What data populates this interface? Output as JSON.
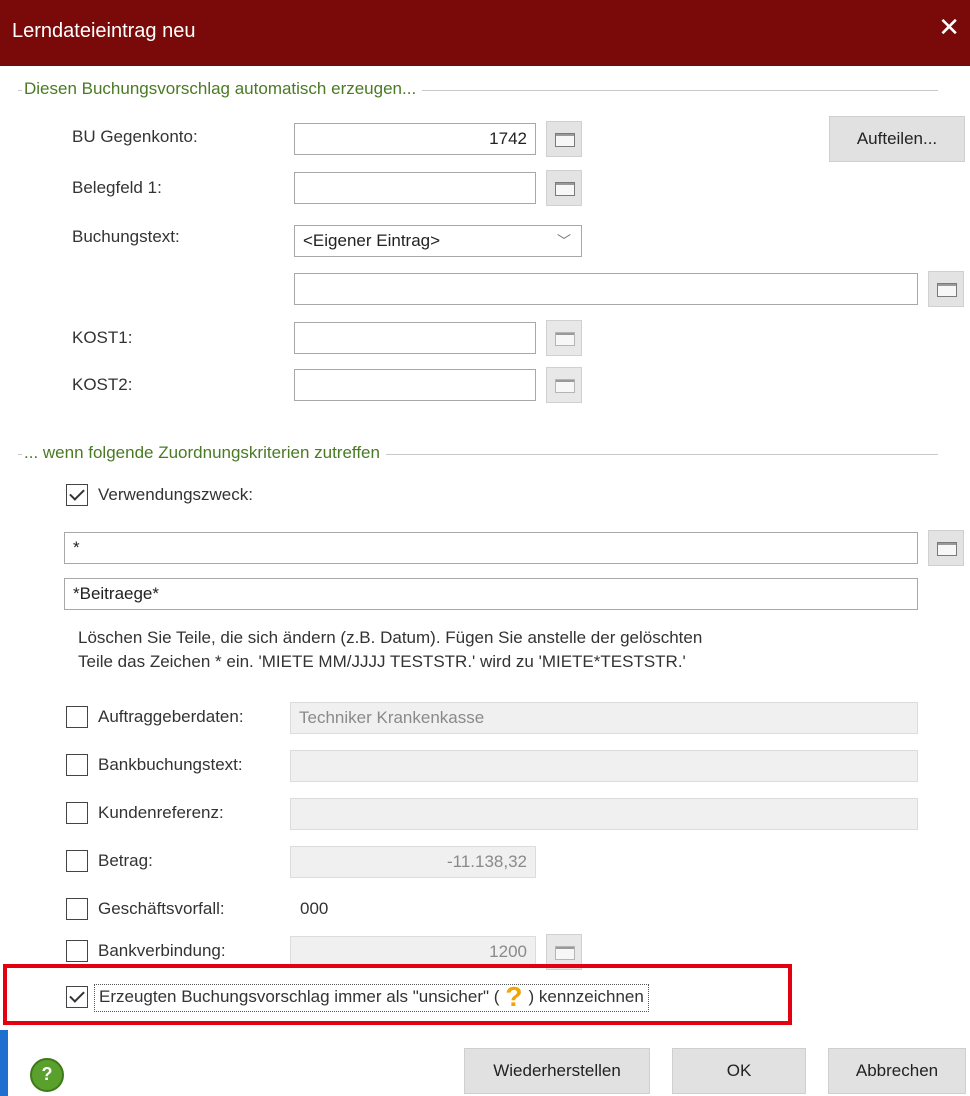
{
  "window": {
    "title": "Lerndateieintrag neu",
    "close_icon": "close-icon"
  },
  "group1": {
    "title": "Diesen Buchungsvorschlag automatisch erzeugen..."
  },
  "bu_gegenkonto": {
    "label": "BU Gegenkonto:",
    "value": "1742"
  },
  "belegfeld1": {
    "label": "Belegfeld 1:",
    "value": ""
  },
  "buchungstext": {
    "label": "Buchungstext:",
    "selected": "<Eigener Eintrag>",
    "text_value": ""
  },
  "aufteilen": {
    "label": "Aufteilen..."
  },
  "kost1": {
    "label": "KOST1:",
    "value": ""
  },
  "kost2": {
    "label": "KOST2:",
    "value": ""
  },
  "group2": {
    "title": "... wenn folgende Zuordnungskriterien zutreffen"
  },
  "verwendungszweck": {
    "label": "Verwendungszweck:",
    "checked": true,
    "value1": "*",
    "value2": "*Beitraege*"
  },
  "hint": {
    "line1": "Löschen Sie Teile, die sich ändern (z.B. Datum). Fügen Sie anstelle der gelöschten",
    "line2": "Teile das Zeichen * ein. 'MIETE MM/JJJJ TESTSTR.' wird zu 'MIETE*TESTSTR.'"
  },
  "criteria": {
    "auftraggeberdaten": {
      "label": "Auftraggeberdaten:",
      "value": "Techniker Krankenkasse",
      "checked": false
    },
    "bankbuchungstext": {
      "label": "Bankbuchungstext:",
      "value": "",
      "checked": false
    },
    "kundenreferenz": {
      "label": "Kundenreferenz:",
      "value": "",
      "checked": false
    },
    "betrag": {
      "label": "Betrag:",
      "value": "-11.138,32",
      "checked": false
    },
    "geschaeftsvorfall": {
      "label": "Geschäftsvorfall:",
      "value": "000",
      "checked": false
    },
    "bankverbindung": {
      "label": "Bankverbindung:",
      "value": "1200",
      "checked": false
    }
  },
  "unsicher": {
    "checked": true,
    "text_before": "Erzeugten Buchungsvorschlag immer als \"unsicher\" (",
    "text_after": ") kennzeichnen"
  },
  "footer": {
    "help_label": "?",
    "restore": "Wiederherstellen",
    "ok": "OK",
    "cancel": "Abbrechen"
  },
  "colors": {
    "titlebar": "#7a0a0a",
    "group_title": "#4a7a23",
    "highlight": "#e3000f",
    "help": "#5aa02c",
    "question": "#f0a500"
  }
}
